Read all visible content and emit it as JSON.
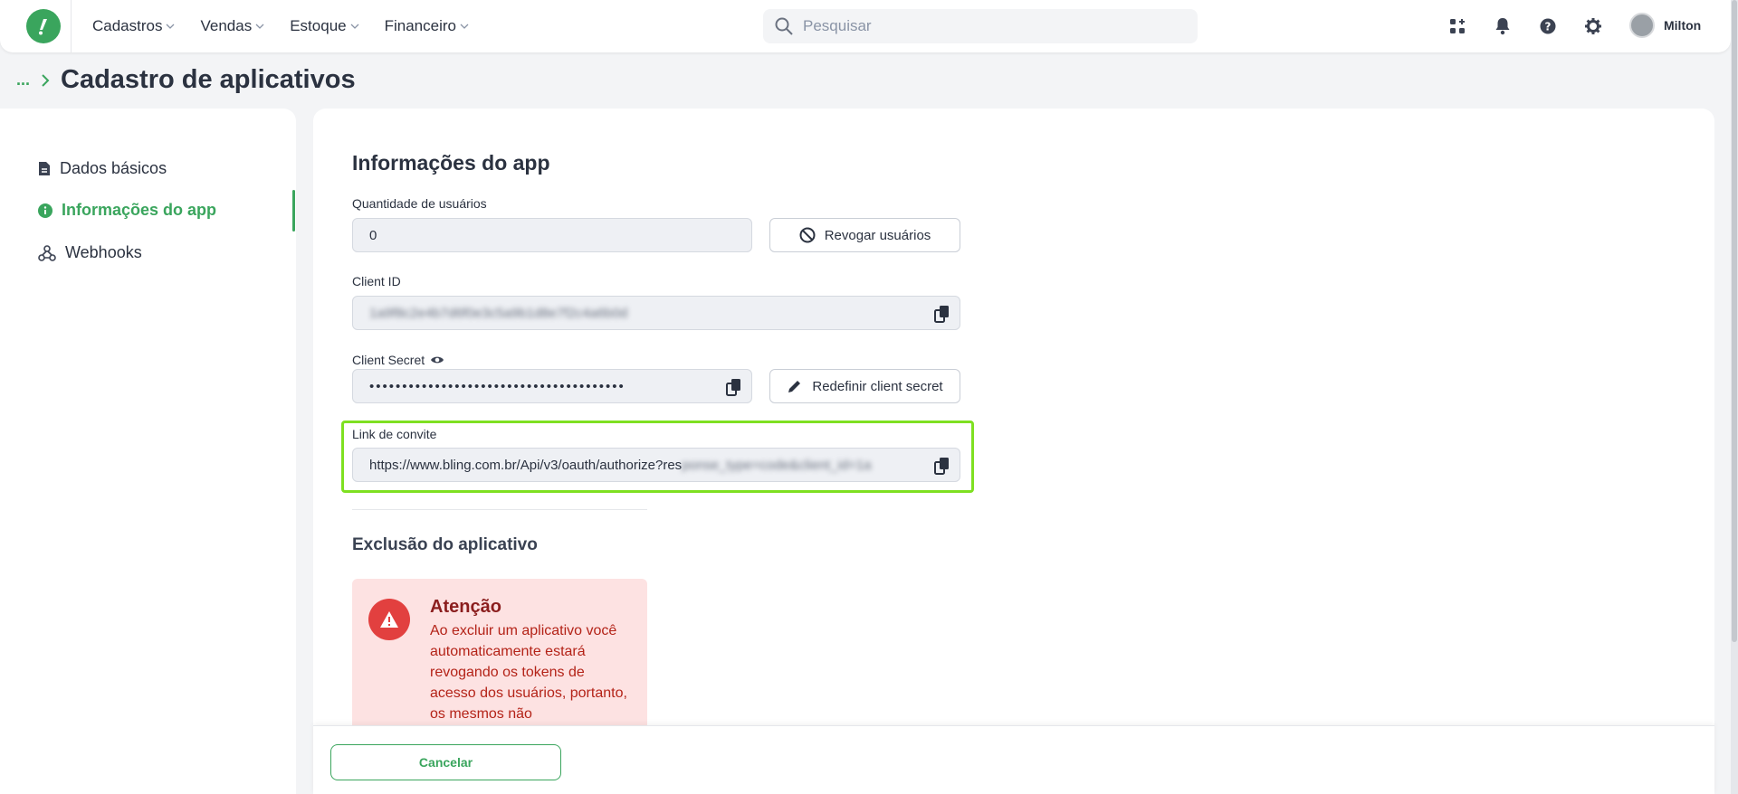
{
  "colors": {
    "brand": "#3aa55d",
    "highlight": "#7ee021",
    "danger": "#e2403f"
  },
  "nav": {
    "items": [
      {
        "label": "Cadastros"
      },
      {
        "label": "Vendas"
      },
      {
        "label": "Estoque"
      },
      {
        "label": "Financeiro"
      }
    ],
    "search_placeholder": "Pesquisar",
    "icons": [
      "apps-icon",
      "bell-icon",
      "help-icon",
      "gear-icon"
    ],
    "user_name": "Milton"
  },
  "breadcrumb": {
    "ellipsis": "...",
    "title": "Cadastro de aplicativos"
  },
  "sidebar": {
    "items": [
      {
        "label": "Dados básicos",
        "icon": "document-icon"
      },
      {
        "label": "Informações do app",
        "icon": "info-icon",
        "active": true
      },
      {
        "label": "Webhooks",
        "icon": "webhook-icon"
      }
    ]
  },
  "form": {
    "section_title": "Informações do app",
    "users_label": "Quantidade de usuários",
    "users_value": "0",
    "revoke_button": "Revogar usuários",
    "client_id_label": "Client ID",
    "client_id_value": "1a9f8c2e4b7d6f0e3c5a9b1d8e7f2c4a6b0d",
    "client_secret_label": "Client Secret",
    "client_secret_value": "•••••••••••••••••••••••••••••••••••••••",
    "redefine_button": "Redefinir client secret",
    "invite_label": "Link de convite",
    "invite_value": "https://www.bling.com.br/Api/v3/oauth/authorize?res",
    "invite_blurred": "ponse_type=code&client_id=1a9f8c2e4b7d6f0e3c5a9b1d8e"
  },
  "deletion": {
    "title": "Exclusão do aplicativo",
    "alert_title": "Atenção",
    "alert_text": "Ao excluir um aplicativo você automaticamente estará revogando os tokens de acesso dos usuários, portanto, os mesmos não"
  },
  "footer": {
    "cancel_button": "Cancelar"
  }
}
